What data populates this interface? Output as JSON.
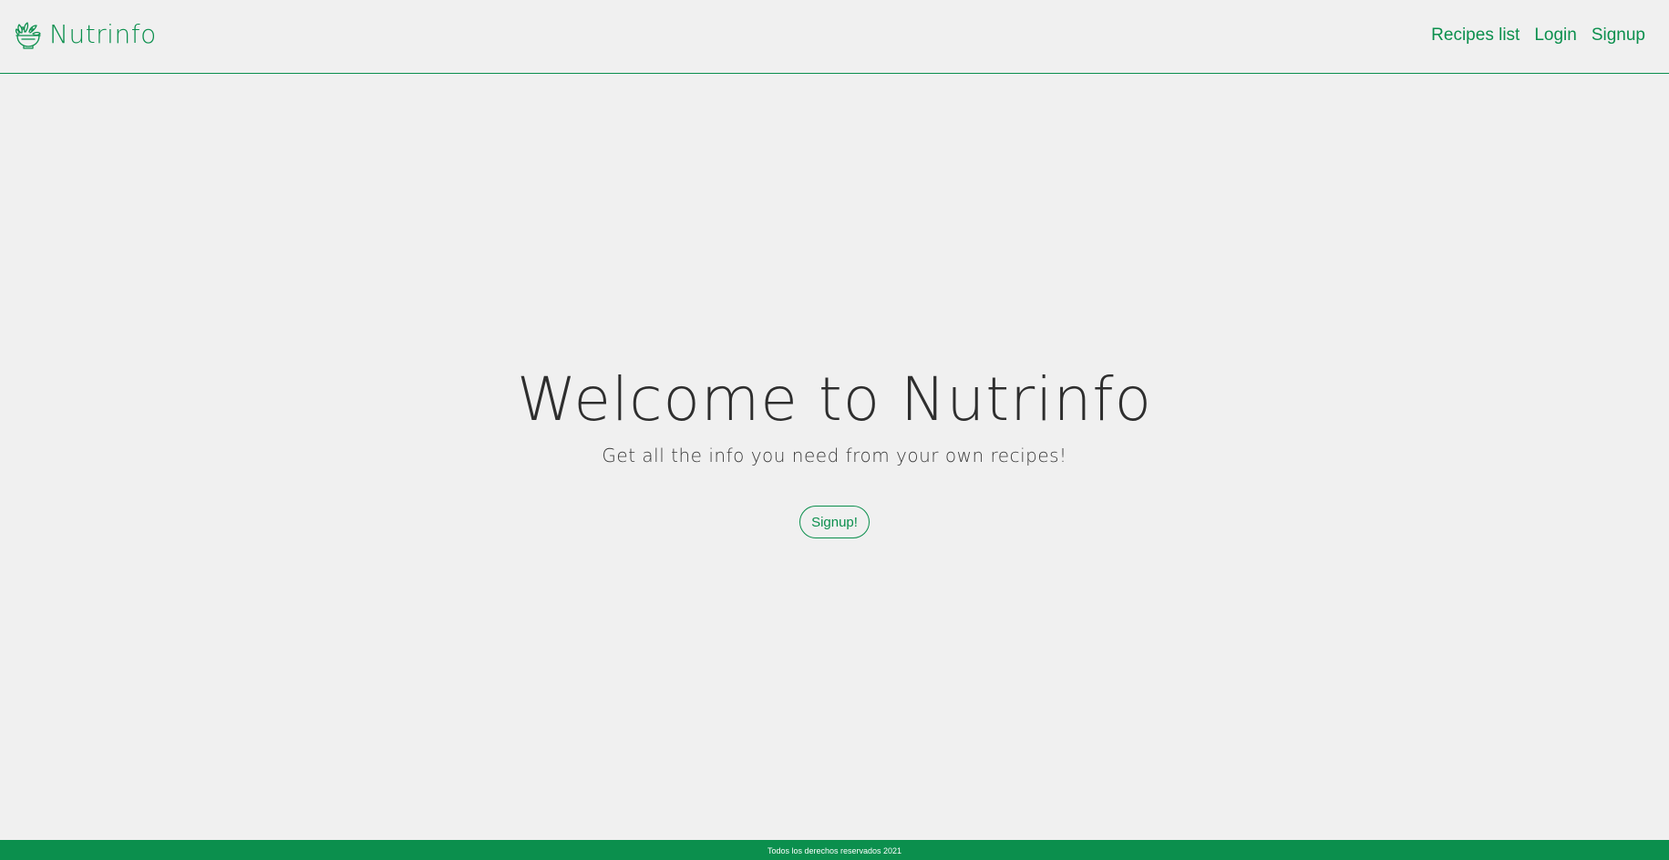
{
  "header": {
    "brand_name": "Nutrinfo",
    "brand_icon": "salad-bowl-icon",
    "nav": [
      {
        "label": "Recipes list"
      },
      {
        "label": "Login"
      },
      {
        "label": "Signup"
      }
    ]
  },
  "hero": {
    "title": "Welcome to Nutrinfo",
    "subtitle": "Get all the info you need from your own recipes!",
    "cta_label": "Signup!"
  },
  "footer": {
    "text": "Todos los derechos reservados 2021"
  },
  "colors": {
    "accent": "#0b8f4d",
    "background": "#f0f0f0",
    "text": "#2e2e2e"
  }
}
